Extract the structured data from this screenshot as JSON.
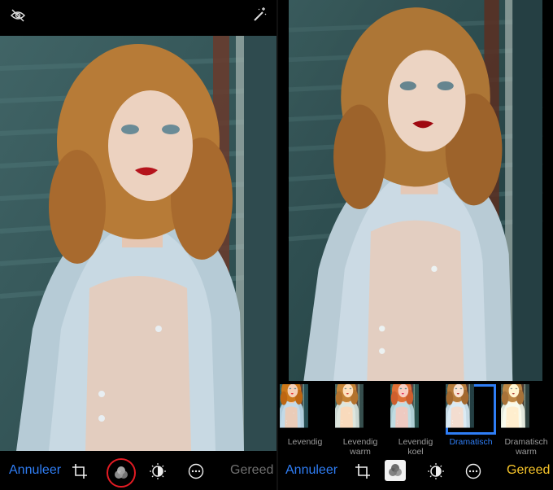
{
  "left_panel": {
    "top_icons": [
      "eye-slash-icon",
      "magic-wand-icon"
    ],
    "bottom": {
      "cancel_label": "Annuleer",
      "done_label": "Gereed",
      "tools": [
        "crop-icon",
        "filters-icon",
        "adjust-icon",
        "more-icon"
      ],
      "highlight_color": "#e31b23"
    }
  },
  "right_panel": {
    "filters": [
      {
        "label1": "Levendig",
        "label2": ""
      },
      {
        "label1": "Levendig",
        "label2": "warm"
      },
      {
        "label1": "Levendig",
        "label2": "koel"
      },
      {
        "label1": "Dramatisch",
        "label2": ""
      },
      {
        "label1": "Dramatisch",
        "label2": "warm"
      }
    ],
    "selected_filter": "Dramatisch",
    "bottom": {
      "cancel_label": "Annuleer",
      "done_label": "Gereed",
      "tools": [
        "crop-icon",
        "filters-icon",
        "adjust-icon",
        "more-icon"
      ]
    }
  },
  "colors": {
    "accent": "#2f7ef6",
    "done_active": "#f7c52a",
    "done_inactive": "#707070"
  }
}
